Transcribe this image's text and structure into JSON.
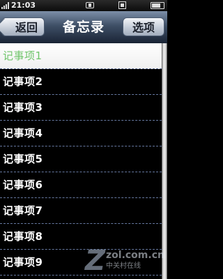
{
  "status_bar": {
    "time": "21:03",
    "icons": [
      "signal-icon",
      "message-icon",
      "profile-icon",
      "battery-icon"
    ]
  },
  "header": {
    "back_label": "返回",
    "title": "备忘录",
    "options_label": "选项"
  },
  "memo_list": {
    "selected_index": 0,
    "items": [
      {
        "label": "记事项1"
      },
      {
        "label": "记事项2"
      },
      {
        "label": "记事项3"
      },
      {
        "label": "记事项4"
      },
      {
        "label": "记事项5"
      },
      {
        "label": "记事项6"
      },
      {
        "label": "记事项7"
      },
      {
        "label": "记事项8"
      },
      {
        "label": "记事项9"
      }
    ]
  },
  "watermark": {
    "site": "zol.com.cn",
    "name_cn": "中关村在线"
  },
  "colors": {
    "selected_text": "#6fc56a",
    "header_top": "#7c8fa8",
    "header_bottom": "#1a2435",
    "divider": "#6678a0"
  }
}
